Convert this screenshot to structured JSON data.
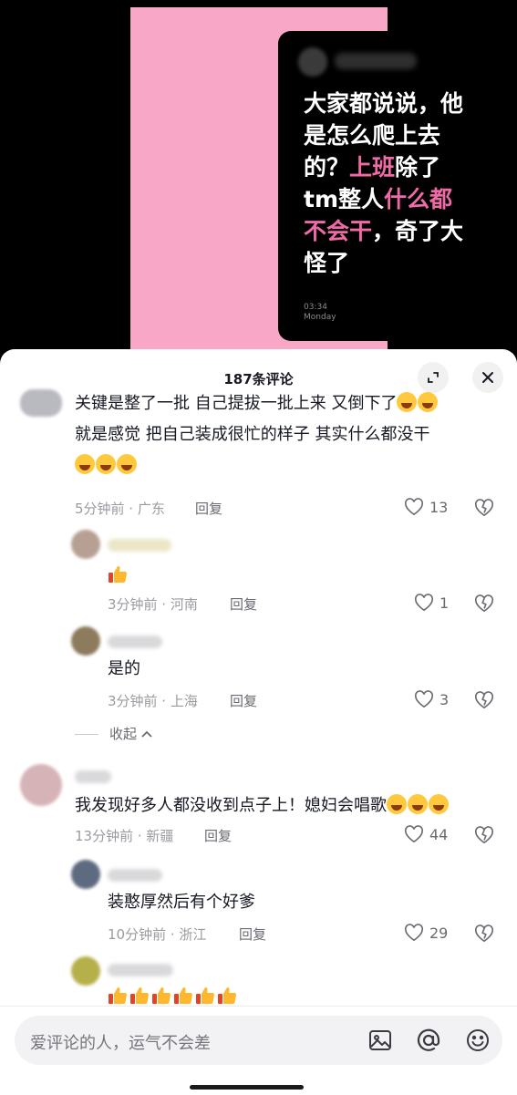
{
  "post_image": {
    "text_lines": [
      [
        {
          "t": "大家都说说，他",
          "pink": false
        }
      ],
      [
        {
          "t": "是怎么爬上去",
          "pink": false
        }
      ],
      [
        {
          "t": "的？",
          "pink": false
        },
        {
          "t": "上班",
          "pink": true
        },
        {
          "t": "除了",
          "pink": false
        }
      ],
      [
        {
          "t": "tm整人",
          "pink": false
        },
        {
          "t": "什么都",
          "pink": true
        }
      ],
      [
        {
          "t": "不会干",
          "pink": true
        },
        {
          "t": "，奇了大",
          "pink": false
        }
      ],
      [
        {
          "t": "怪了",
          "pink": false
        }
      ]
    ],
    "time": "03:34",
    "day": "Monday"
  },
  "sheet": {
    "title": "187条评论",
    "expand_icon": "expand-icon",
    "close_icon": "close-icon"
  },
  "comments": [
    {
      "line1": "关键是整了一批  自己提拔一批上来  又倒下了",
      "line1_emoji": 2,
      "line2": "就是感觉 把自己装成很忙的样子  其实什么都没干",
      "line3_emoji": 3,
      "meta": "5分钟前 · 广东",
      "reply": "回复",
      "likes": "13"
    },
    {
      "text_emoji": "thumbs-up",
      "meta": "3分钟前 · 河南",
      "reply": "回复",
      "likes": "1"
    },
    {
      "text": "是的",
      "meta": "3分钟前 · 上海",
      "reply": "回复",
      "likes": "3"
    },
    {
      "text": "我发现好多人都没收到点子上！媳妇会唱歌",
      "text_emoji": 3,
      "meta": "13分钟前 · 新疆",
      "reply": "回复",
      "likes": "44"
    },
    {
      "text": "装憨厚然后有个好爹",
      "meta": "10分钟前 · 浙江",
      "reply": "回复",
      "likes": "29"
    },
    {
      "text_emoji": "thumbs-up x6"
    }
  ],
  "collapse": {
    "label": "收起",
    "icon": "chevron-up-icon"
  },
  "input": {
    "placeholder": "爱评论的人，运气不会差",
    "icons": [
      "image-icon",
      "at-icon",
      "emoji-icon"
    ]
  },
  "colors": {
    "accent_pink": "#f06aa7",
    "frame_pink": "#f8a7c6",
    "text": "#161823",
    "meta": "#9a9ba1"
  }
}
